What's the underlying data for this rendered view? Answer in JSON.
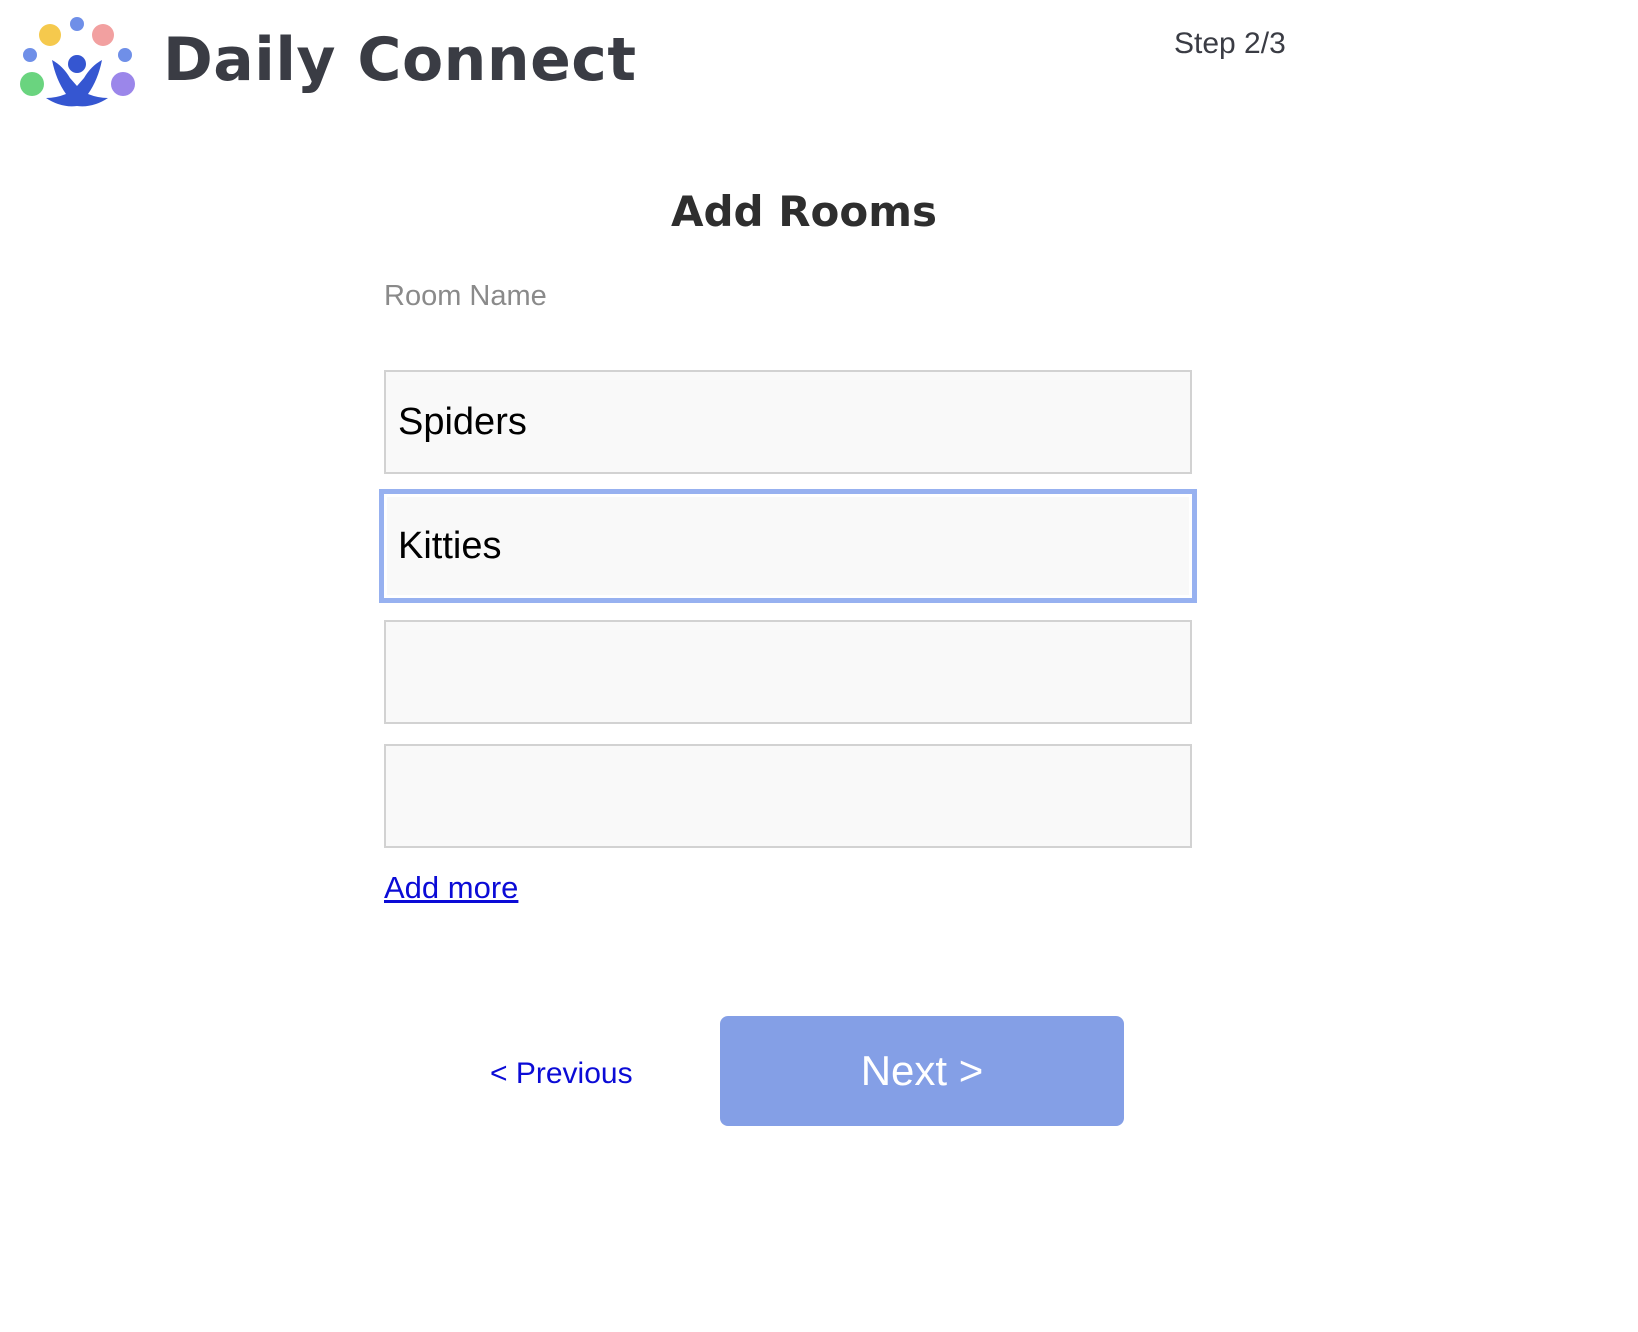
{
  "header": {
    "app_title": "Daily Connect",
    "step": "Step 2/3",
    "logo_colors": {
      "yellow": "#f5c94d",
      "pink": "#f2a0a0",
      "small_dots": "#6f8fe8",
      "green": "#6ad47f",
      "purple": "#9b86ea",
      "figure": "#3556d1"
    }
  },
  "main": {
    "title": "Add Rooms",
    "field_label": "Room Name",
    "rooms": [
      {
        "value": "Spiders"
      },
      {
        "value": "Kitties"
      },
      {
        "value": ""
      },
      {
        "value": ""
      }
    ],
    "add_more_label": "Add more"
  },
  "footer": {
    "previous_label": "< Previous",
    "next_label": "Next >"
  },
  "colors": {
    "link": "#0b0bd6",
    "next_button_bg": "#849fe6",
    "focus_ring": "#97b1f0"
  }
}
